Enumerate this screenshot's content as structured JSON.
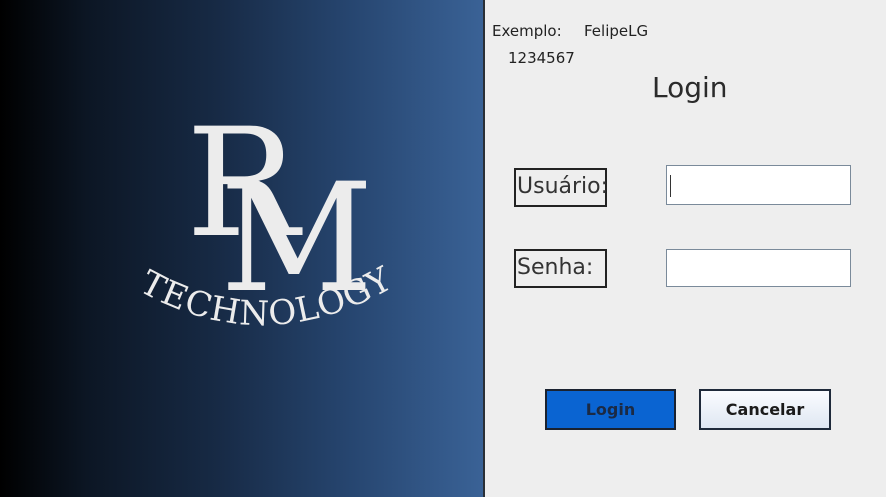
{
  "brand": {
    "monogram": "RM",
    "wordmark": "TECHNOLOGY"
  },
  "hint": {
    "label": "Exemplo:",
    "user": "FelipeLG",
    "password": "1234567"
  },
  "title": "Login",
  "form": {
    "user_label": "Usuário:",
    "password_label": "Senha:",
    "user_value": "",
    "password_value": ""
  },
  "buttons": {
    "login": "Login",
    "cancel": "Cancelar"
  },
  "colors": {
    "login_button": "#0a64d2",
    "panel_dark": "#000000",
    "panel_light": "#3a6296"
  }
}
